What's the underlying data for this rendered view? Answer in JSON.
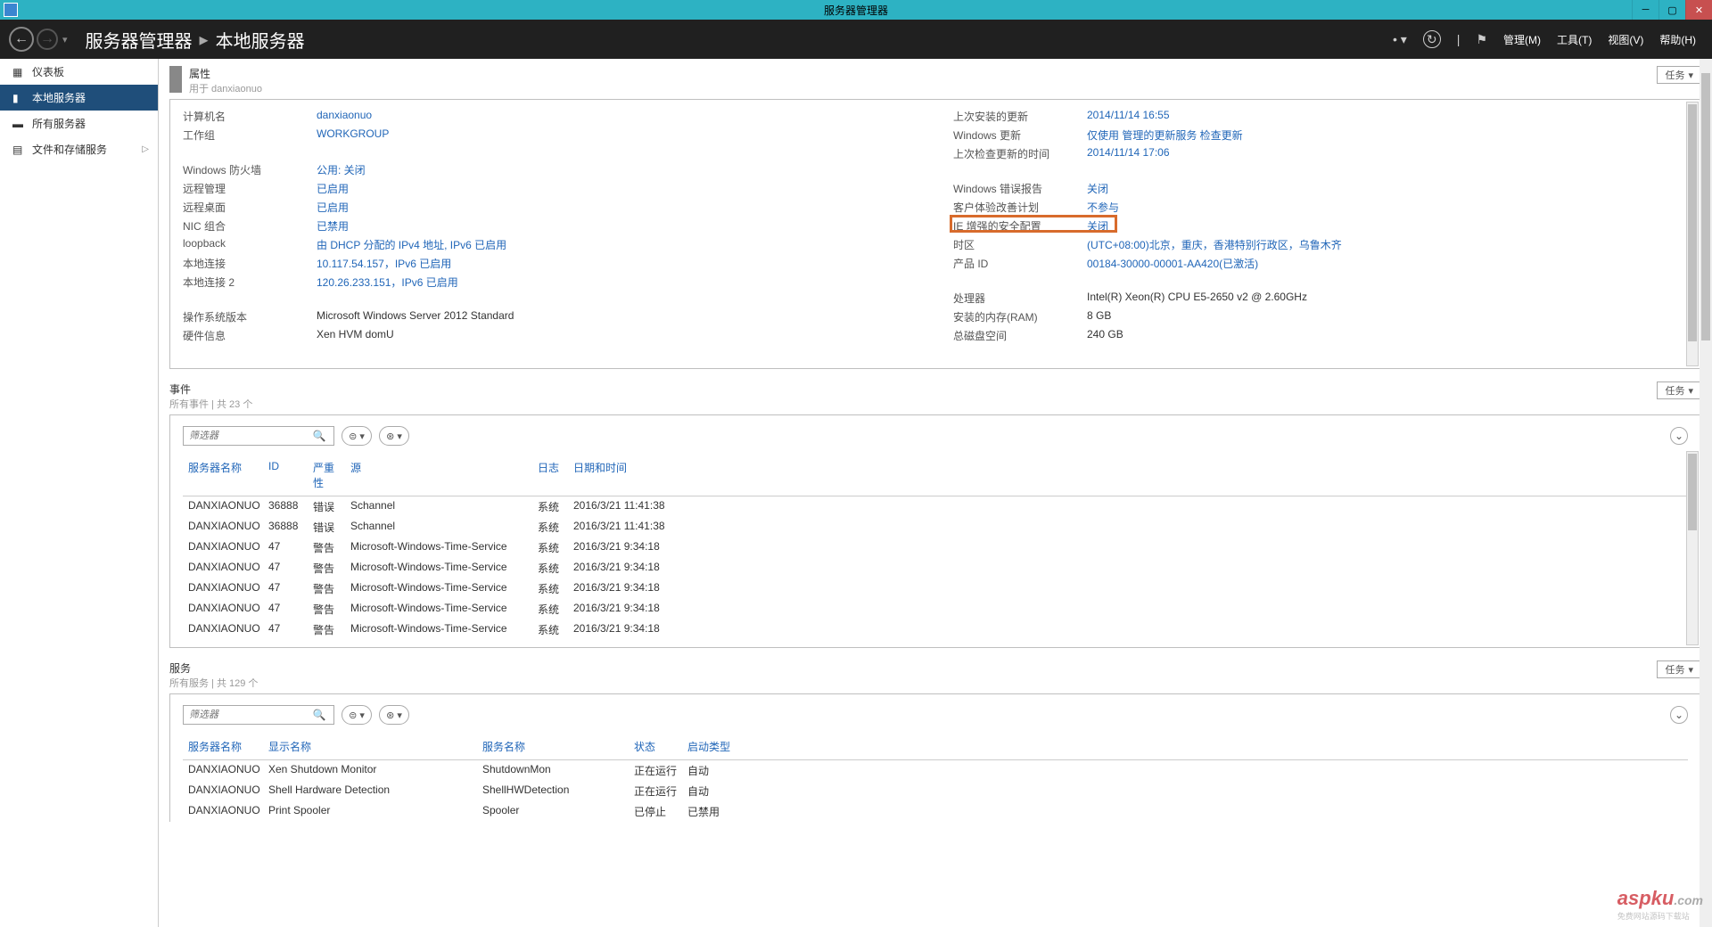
{
  "window": {
    "title": "服务器管理器"
  },
  "breadcrumb": {
    "app": "服务器管理器",
    "page": "本地服务器"
  },
  "headerMenus": {
    "manage": "管理(M)",
    "tools": "工具(T)",
    "view": "视图(V)",
    "help": "帮助(H)"
  },
  "sidebar": {
    "items": [
      {
        "label": "仪表板"
      },
      {
        "label": "本地服务器"
      },
      {
        "label": "所有服务器"
      },
      {
        "label": "文件和存储服务"
      }
    ]
  },
  "tasksLabel": "任务",
  "properties": {
    "title": "属性",
    "subtitle": "用于 danxiaonuo",
    "left": [
      [
        {
          "label": "计算机名",
          "value": "danxiaonuo"
        },
        {
          "label": "工作组",
          "value": "WORKGROUP"
        }
      ],
      [
        {
          "label": "Windows 防火墙",
          "value": "公用: 关闭"
        },
        {
          "label": "远程管理",
          "value": "已启用"
        },
        {
          "label": "远程桌面",
          "value": "已启用"
        },
        {
          "label": "NIC 组合",
          "value": "已禁用"
        },
        {
          "label": "loopback",
          "value": "由 DHCP 分配的 IPv4 地址, IPv6 已启用"
        },
        {
          "label": "本地连接",
          "value": "10.117.54.157，IPv6 已启用"
        },
        {
          "label": "本地连接 2",
          "value": "120.26.233.151，IPv6 已启用"
        }
      ],
      [
        {
          "label": "操作系统版本",
          "value": "Microsoft Windows Server 2012 Standard",
          "plain": true
        },
        {
          "label": "硬件信息",
          "value": "Xen HVM domU",
          "plain": true
        }
      ]
    ],
    "right": [
      [
        {
          "label": "上次安装的更新",
          "value": "2014/11/14 16:55"
        },
        {
          "label": "Windows 更新",
          "value": "仅使用 管理的更新服务 检查更新"
        },
        {
          "label": "上次检查更新的时间",
          "value": "2014/11/14 17:06"
        }
      ],
      [
        {
          "label": "Windows 错误报告",
          "value": "关闭"
        },
        {
          "label": "客户体验改善计划",
          "value": "不参与"
        },
        {
          "label": "IE 增强的安全配置",
          "value": "关闭",
          "highlight": true
        },
        {
          "label": "时区",
          "value": "(UTC+08:00)北京，重庆，香港特别行政区，乌鲁木齐"
        },
        {
          "label": "产品 ID",
          "value": "00184-30000-00001-AA420(已激活)"
        }
      ],
      [
        {
          "label": "处理器",
          "value": "Intel(R) Xeon(R) CPU E5-2650 v2 @ 2.60GHz",
          "plain": true
        },
        {
          "label": "安装的内存(RAM)",
          "value": "8 GB",
          "plain": true
        },
        {
          "label": "总磁盘空间",
          "value": "240 GB",
          "plain": true
        }
      ]
    ]
  },
  "events": {
    "title": "事件",
    "subtitle": "所有事件 | 共 23 个",
    "filterPlaceholder": "筛选器",
    "columns": {
      "server": "服务器名称",
      "id": "ID",
      "severity": "严重性",
      "source": "源",
      "log": "日志",
      "datetime": "日期和时间"
    },
    "rows": [
      {
        "server": "DANXIAONUO",
        "id": "36888",
        "severity": "错误",
        "source": "Schannel",
        "log": "系统",
        "datetime": "2016/3/21 11:41:38"
      },
      {
        "server": "DANXIAONUO",
        "id": "36888",
        "severity": "错误",
        "source": "Schannel",
        "log": "系统",
        "datetime": "2016/3/21 11:41:38"
      },
      {
        "server": "DANXIAONUO",
        "id": "47",
        "severity": "警告",
        "source": "Microsoft-Windows-Time-Service",
        "log": "系统",
        "datetime": "2016/3/21 9:34:18"
      },
      {
        "server": "DANXIAONUO",
        "id": "47",
        "severity": "警告",
        "source": "Microsoft-Windows-Time-Service",
        "log": "系统",
        "datetime": "2016/3/21 9:34:18"
      },
      {
        "server": "DANXIAONUO",
        "id": "47",
        "severity": "警告",
        "source": "Microsoft-Windows-Time-Service",
        "log": "系统",
        "datetime": "2016/3/21 9:34:18"
      },
      {
        "server": "DANXIAONUO",
        "id": "47",
        "severity": "警告",
        "source": "Microsoft-Windows-Time-Service",
        "log": "系统",
        "datetime": "2016/3/21 9:34:18"
      },
      {
        "server": "DANXIAONUO",
        "id": "47",
        "severity": "警告",
        "source": "Microsoft-Windows-Time-Service",
        "log": "系统",
        "datetime": "2016/3/21 9:34:18"
      }
    ]
  },
  "services": {
    "title": "服务",
    "subtitle": "所有服务 | 共 129 个",
    "filterPlaceholder": "筛选器",
    "columns": {
      "server": "服务器名称",
      "display": "显示名称",
      "svcname": "服务名称",
      "status": "状态",
      "start": "启动类型"
    },
    "rows": [
      {
        "server": "DANXIAONUO",
        "display": "Xen Shutdown Monitor",
        "svcname": "ShutdownMon",
        "status": "正在运行",
        "start": "自动"
      },
      {
        "server": "DANXIAONUO",
        "display": "Shell Hardware Detection",
        "svcname": "ShellHWDetection",
        "status": "正在运行",
        "start": "自动"
      },
      {
        "server": "DANXIAONUO",
        "display": "Print Spooler",
        "svcname": "Spooler",
        "status": "已停止",
        "start": "已禁用"
      }
    ]
  },
  "watermark": {
    "main": "aspku",
    "suffix": ".com",
    "sub": "免费网站源码下载站"
  }
}
